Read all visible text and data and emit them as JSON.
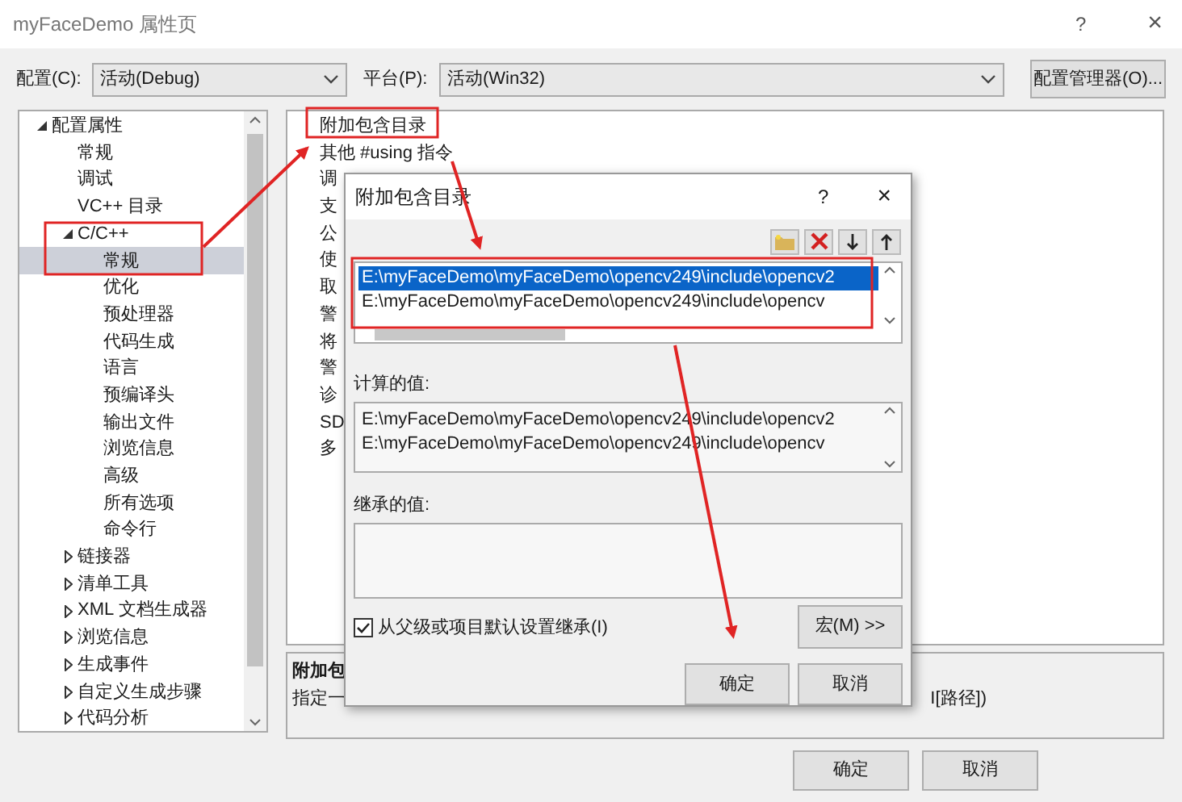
{
  "window": {
    "title": "myFaceDemo 属性页",
    "help": "?",
    "close": "×"
  },
  "config_bar": {
    "configuration_label": "配置(C):",
    "configuration": "活动(Debug)",
    "platform_label": "平台(P):",
    "platform": "活动(Win32)",
    "manager_button": "配置管理器(O)..."
  },
  "tree": [
    {
      "label": "配置属性",
      "expanded": true,
      "selected": false,
      "children": [
        {
          "label": "常规",
          "selected": false
        },
        {
          "label": "调试",
          "selected": false
        },
        {
          "label": "VC++ 目录",
          "selected": false
        },
        {
          "label": "C/C++",
          "expanded": true,
          "selected": false,
          "children": [
            {
              "label": "常规",
              "selected": true
            },
            {
              "label": "优化",
              "selected": false
            },
            {
              "label": "预处理器",
              "selected": false
            },
            {
              "label": "代码生成",
              "selected": false
            },
            {
              "label": "语言",
              "selected": false
            },
            {
              "label": "预编译头",
              "selected": false
            },
            {
              "label": "输出文件",
              "selected": false
            },
            {
              "label": "浏览信息",
              "selected": false
            },
            {
              "label": "高级",
              "selected": false
            },
            {
              "label": "所有选项",
              "selected": false
            },
            {
              "label": "命令行",
              "selected": false
            }
          ]
        },
        {
          "label": "链接器",
          "expanded": false,
          "selected": false
        },
        {
          "label": "清单工具",
          "expanded": false,
          "selected": false
        },
        {
          "label": "XML 文档生成器",
          "expanded": false,
          "selected": false
        },
        {
          "label": "浏览信息",
          "expanded": false,
          "selected": false
        },
        {
          "label": "生成事件",
          "expanded": false,
          "selected": false
        },
        {
          "label": "自定义生成步骤",
          "expanded": false,
          "selected": false
        },
        {
          "label": "代码分析",
          "expanded": false,
          "selected": false
        }
      ]
    }
  ],
  "properties": [
    {
      "name": "附加包含目录"
    },
    {
      "name": "其他 #using 指令"
    },
    {
      "name": "调"
    },
    {
      "name": "支"
    },
    {
      "name": "公"
    },
    {
      "name": "使"
    },
    {
      "name": "取"
    },
    {
      "name": "警"
    },
    {
      "name": "将"
    },
    {
      "name": "警"
    },
    {
      "name": "诊"
    },
    {
      "name": "SD"
    },
    {
      "name": "多"
    }
  ],
  "description": {
    "title": "附加包",
    "text": "指定一",
    "text_end": "I[路径])"
  },
  "dialog": {
    "title": "附加包含目录",
    "help": "?",
    "close": "×",
    "entries": [
      {
        "text": "E:\\myFaceDemo\\myFaceDemo\\opencv249\\include\\opencv2",
        "selected": true
      },
      {
        "text": "E:\\myFaceDemo\\myFaceDemo\\opencv249\\include\\opencv",
        "selected": false
      }
    ],
    "computed_label": "计算的值:",
    "computed": [
      "E:\\myFaceDemo\\myFaceDemo\\opencv249\\include\\opencv2",
      "E:\\myFaceDemo\\myFaceDemo\\opencv249\\include\\opencv"
    ],
    "inherited_label": "继承的值:",
    "inherit": {
      "label": "从父级或项目默认设置继承(I)",
      "checked": true
    },
    "macros_button": "宏(M) >>",
    "ok": "确定",
    "cancel": "取消"
  },
  "buttons": [
    "确定",
    "取消"
  ]
}
